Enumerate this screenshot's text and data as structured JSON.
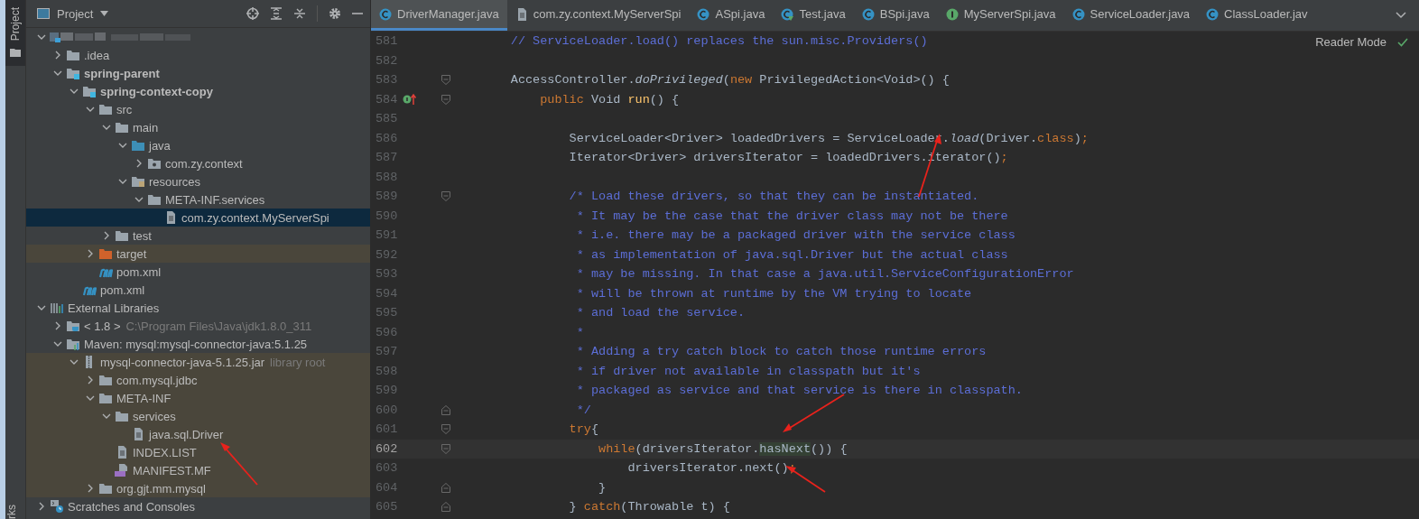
{
  "tool_stripe": {
    "project_tab": "Project",
    "bottom_tab": "rks"
  },
  "project_panel": {
    "title": "Project",
    "tree": [
      {
        "kind": "redacted",
        "expanded": true,
        "selected": false,
        "highlighted": false,
        "children": [
          {
            "label": ".idea",
            "kind": "folder",
            "expanded": false,
            "selected": false,
            "highlighted": false
          },
          {
            "label": "spring-parent",
            "kind": "module",
            "bold": true,
            "expanded": true,
            "selected": false,
            "highlighted": false,
            "children": [
              {
                "label": "spring-context-copy",
                "kind": "module",
                "bold": true,
                "expanded": true,
                "selected": false,
                "highlighted": false,
                "children": [
                  {
                    "label": "src",
                    "kind": "folder",
                    "expanded": true,
                    "selected": false,
                    "highlighted": false,
                    "children": [
                      {
                        "label": "main",
                        "kind": "folder",
                        "expanded": true,
                        "selected": false,
                        "highlighted": false,
                        "children": [
                          {
                            "label": "java",
                            "kind": "source",
                            "expanded": true,
                            "selected": false,
                            "highlighted": false,
                            "children": [
                              {
                                "label": "com.zy.context",
                                "kind": "package",
                                "expanded": false,
                                "selected": false,
                                "highlighted": false
                              }
                            ]
                          },
                          {
                            "label": "resources",
                            "kind": "resources",
                            "expanded": true,
                            "selected": false,
                            "highlighted": false,
                            "children": [
                              {
                                "label": "META-INF.services",
                                "kind": "folder",
                                "expanded": true,
                                "selected": false,
                                "highlighted": false,
                                "children": [
                                  {
                                    "label": "com.zy.context.MyServerSpi",
                                    "kind": "file",
                                    "selected": true,
                                    "highlighted": false
                                  }
                                ]
                              }
                            ]
                          }
                        ]
                      },
                      {
                        "label": "test",
                        "kind": "folder",
                        "expanded": false,
                        "selected": false,
                        "highlighted": false
                      }
                    ]
                  },
                  {
                    "label": "target",
                    "kind": "excluded",
                    "expanded": false,
                    "selected": false,
                    "highlighted": true
                  },
                  {
                    "label": "pom.xml",
                    "kind": "maven",
                    "selected": false,
                    "highlighted": false
                  }
                ]
              },
              {
                "label": "pom.xml",
                "kind": "maven",
                "selected": false,
                "highlighted": false
              }
            ]
          }
        ]
      },
      {
        "label": "External Libraries",
        "kind": "libraries",
        "expanded": true,
        "selected": false,
        "highlighted": false,
        "children": [
          {
            "label": "< 1.8 >",
            "hint": "C:\\Program Files\\Java\\jdk1.8.0_311",
            "kind": "jdk",
            "expanded": false,
            "selected": false,
            "highlighted": false
          },
          {
            "label": "Maven: mysql:mysql-connector-java:5.1.25",
            "kind": "maven-lib",
            "expanded": true,
            "selected": false,
            "highlighted": false,
            "children": [
              {
                "label": "mysql-connector-java-5.1.25.jar",
                "hint": "library root",
                "kind": "jar",
                "expanded": true,
                "selected": false,
                "highlighted": true,
                "children": [
                  {
                    "label": "com.mysql.jdbc",
                    "kind": "folder",
                    "expanded": false,
                    "selected": false,
                    "highlighted": true
                  },
                  {
                    "label": "META-INF",
                    "kind": "folder",
                    "expanded": true,
                    "selected": false,
                    "highlighted": true,
                    "children": [
                      {
                        "label": "services",
                        "kind": "folder",
                        "expanded": true,
                        "selected": false,
                        "highlighted": true,
                        "children": [
                          {
                            "label": "java.sql.Driver",
                            "kind": "file",
                            "selected": false,
                            "highlighted": true
                          }
                        ]
                      },
                      {
                        "label": "INDEX.LIST",
                        "kind": "file",
                        "selected": false,
                        "highlighted": true
                      },
                      {
                        "label": "MANIFEST.MF",
                        "kind": "manifest",
                        "selected": false,
                        "highlighted": true
                      }
                    ]
                  },
                  {
                    "label": "org.gjt.mm.mysql",
                    "kind": "folder",
                    "expanded": false,
                    "selected": false,
                    "highlighted": true
                  }
                ]
              }
            ]
          }
        ]
      },
      {
        "label": "Scratches and Consoles",
        "kind": "scratches",
        "expanded": false,
        "selected": false,
        "highlighted": false
      }
    ]
  },
  "editor": {
    "tabs": [
      {
        "label": "DriverManager.java",
        "kind": "class",
        "selected": true
      },
      {
        "label": "com.zy.context.MyServerSpi",
        "kind": "file",
        "selected": false
      },
      {
        "label": "ASpi.java",
        "kind": "class",
        "selected": false
      },
      {
        "label": "Test.java",
        "kind": "test",
        "selected": false
      },
      {
        "label": "BSpi.java",
        "kind": "class",
        "selected": false
      },
      {
        "label": "MyServerSpi.java",
        "kind": "interface",
        "selected": false
      },
      {
        "label": "ServiceLoader.java",
        "kind": "class",
        "selected": false
      },
      {
        "label": "ClassLoader.jav",
        "kind": "class",
        "selected": false
      }
    ],
    "reader_mode": "Reader Mode",
    "lines": [
      {
        "number": "581",
        "current": false,
        "segments": [
          {
            "kind": "comment",
            "text": "        // ServiceLoader.load() replaces the sun.misc.Providers()"
          }
        ]
      },
      {
        "number": "582",
        "current": false
      },
      {
        "number": "583",
        "current": false,
        "fold_start": true,
        "segments": [
          {
            "kind": "plain",
            "text": "        AccessController."
          },
          {
            "kind": "italic",
            "text": "doPrivileged"
          },
          {
            "kind": "plain",
            "text": "("
          },
          {
            "kind": "keyword",
            "text": "new "
          },
          {
            "kind": "plain",
            "text": "PrivilegedAction<Void>() {"
          }
        ]
      },
      {
        "number": "584",
        "current": false,
        "fold_start": true,
        "override": true,
        "segments": [
          {
            "kind": "keyword",
            "text": "            public "
          },
          {
            "kind": "plain",
            "text": "Void "
          },
          {
            "kind": "method",
            "text": "run"
          },
          {
            "kind": "plain",
            "text": "() {"
          }
        ]
      },
      {
        "number": "585",
        "current": false
      },
      {
        "number": "586",
        "current": false,
        "segments": [
          {
            "kind": "plain",
            "text": "                ServiceLoader<Driver> loadedDrivers = ServiceLoader."
          },
          {
            "kind": "italic",
            "text": "load"
          },
          {
            "kind": "plain",
            "text": "(Driver."
          },
          {
            "kind": "keyword",
            "text": "class"
          },
          {
            "kind": "plain",
            "text": ")"
          },
          {
            "kind": "keyword",
            "text": ";"
          }
        ]
      },
      {
        "number": "587",
        "current": false,
        "segments": [
          {
            "kind": "plain",
            "text": "                Iterator<Driver> driversIterator = loadedDrivers.iterator()"
          },
          {
            "kind": "keyword",
            "text": ";"
          }
        ]
      },
      {
        "number": "588",
        "current": false
      },
      {
        "number": "589",
        "current": false,
        "fold_start": true,
        "segments": [
          {
            "kind": "comment",
            "text": "                /* Load these drivers, so that they can be instantiated."
          }
        ]
      },
      {
        "number": "590",
        "current": false,
        "segments": [
          {
            "kind": "comment",
            "text": "                 * It may be the case that the driver class may not be there"
          }
        ]
      },
      {
        "number": "591",
        "current": false,
        "segments": [
          {
            "kind": "comment",
            "text": "                 * i.e. there may be a packaged driver with the service class"
          }
        ]
      },
      {
        "number": "592",
        "current": false,
        "segments": [
          {
            "kind": "comment",
            "text": "                 * as implementation of java.sql.Driver but the actual class"
          }
        ]
      },
      {
        "number": "593",
        "current": false,
        "segments": [
          {
            "kind": "comment",
            "text": "                 * may be missing. In that case a java.util.ServiceConfigurationError"
          }
        ]
      },
      {
        "number": "594",
        "current": false,
        "segments": [
          {
            "kind": "comment",
            "text": "                 * will be thrown at runtime by the VM trying to locate"
          }
        ]
      },
      {
        "number": "595",
        "current": false,
        "segments": [
          {
            "kind": "comment",
            "text": "                 * and load the service."
          }
        ]
      },
      {
        "number": "596",
        "current": false,
        "segments": [
          {
            "kind": "comment",
            "text": "                 *"
          }
        ]
      },
      {
        "number": "597",
        "current": false,
        "segments": [
          {
            "kind": "comment",
            "text": "                 * Adding a try catch block to catch those runtime errors"
          }
        ]
      },
      {
        "number": "598",
        "current": false,
        "segments": [
          {
            "kind": "comment",
            "text": "                 * if driver not available in classpath but it's"
          }
        ]
      },
      {
        "number": "599",
        "current": false,
        "segments": [
          {
            "kind": "comment",
            "text": "                 * packaged as service and that service is there in classpath."
          }
        ]
      },
      {
        "number": "600",
        "current": false,
        "fold_end": true,
        "segments": [
          {
            "kind": "comment",
            "text": "                 */"
          }
        ]
      },
      {
        "number": "601",
        "current": false,
        "fold_start": true,
        "segments": [
          {
            "kind": "keyword",
            "text": "                try"
          },
          {
            "kind": "plain",
            "text": "{"
          }
        ]
      },
      {
        "number": "602",
        "current": true,
        "fold_start": true,
        "segments": [
          {
            "kind": "keyword",
            "text": "                    while"
          },
          {
            "kind": "plain",
            "text": "(driversIterator."
          },
          {
            "kind": "usage",
            "text": "hasNext"
          },
          {
            "kind": "plain",
            "text": "()) {"
          }
        ]
      },
      {
        "number": "603",
        "current": false,
        "segments": [
          {
            "kind": "plain",
            "text": "                        driversIterator.next()"
          },
          {
            "kind": "keyword",
            "text": ";"
          }
        ]
      },
      {
        "number": "604",
        "current": false,
        "fold_end": true,
        "segments": [
          {
            "kind": "plain",
            "text": "                    }"
          }
        ]
      },
      {
        "number": "605",
        "current": false,
        "fold_end": true,
        "segments": [
          {
            "kind": "plain",
            "text": "                } "
          },
          {
            "kind": "keyword",
            "text": "catch"
          },
          {
            "kind": "plain",
            "text": "(Throwable t) {"
          }
        ]
      }
    ]
  }
}
